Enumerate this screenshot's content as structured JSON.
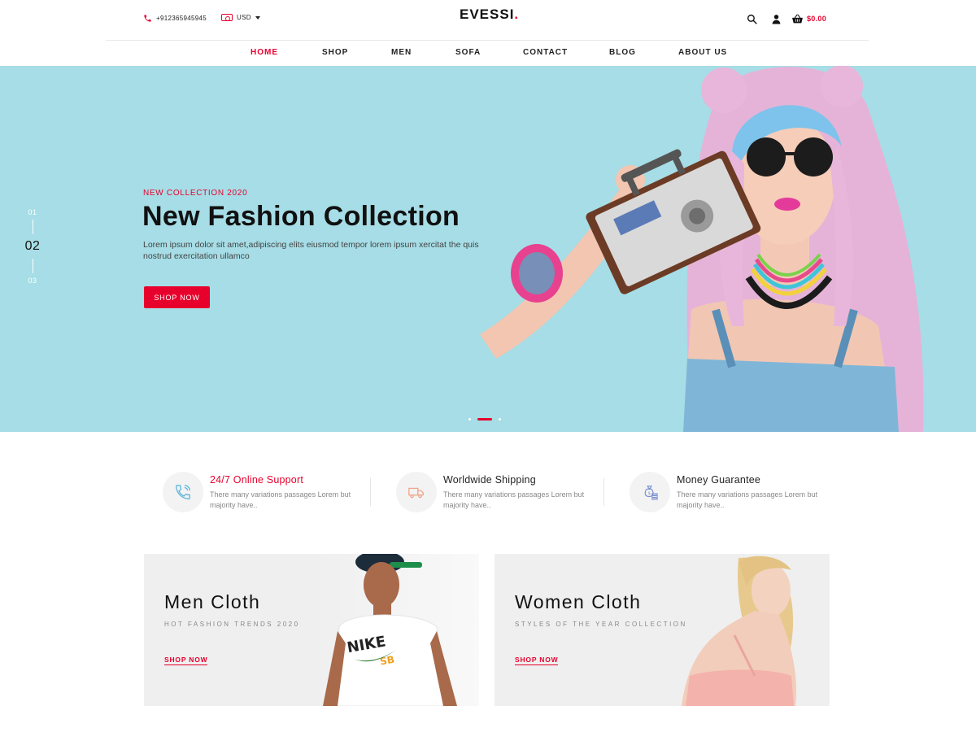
{
  "header": {
    "phone": "+912365945945",
    "currency": "USD",
    "logo_text": "EVESSI",
    "logo_dot": ".",
    "cart_total": "$0.00",
    "icons": [
      "phone-icon",
      "money-icon",
      "search-icon",
      "user-icon",
      "cart-icon"
    ],
    "accent_color": "#e8002c"
  },
  "nav": {
    "items": [
      "HOME",
      "SHOP",
      "MEN",
      "SOFA",
      "CONTACT",
      "BLOG",
      "ABOUT US"
    ],
    "active": "HOME"
  },
  "hero": {
    "slides": [
      "01",
      "02",
      "03"
    ],
    "current_slide": "02",
    "subtitle": "NEW COLLECTION 2020",
    "title": "New Fashion Collection",
    "description": "Lorem ipsum dolor sit amet,adipiscing elits eiusmod tempor lorem ipsum xercitat the quis nostrud exercitation ullamco",
    "button": "SHOP NOW",
    "background_color": "#a6dde6",
    "dot_count": 3,
    "active_dot": 2
  },
  "features": [
    {
      "title": "24/7 Online Support",
      "description": "There many variations passages Lorem but majority have..",
      "icon": "phone-support-icon"
    },
    {
      "title": "Worldwide Shipping",
      "description": "There many variations passages Lorem but majority have..",
      "icon": "truck-icon"
    },
    {
      "title": "Money Guarantee",
      "description": "There many variations passages Lorem but majority have..",
      "icon": "money-bag-icon"
    }
  ],
  "banners": [
    {
      "title": "Men Cloth",
      "subtitle": "HOT FASHION TRENDS 2020",
      "link": "SHOP NOW"
    },
    {
      "title": "Women Cloth",
      "subtitle": "STYLES OF THE YEAR COLLECTION",
      "link": "SHOP NOW"
    }
  ]
}
